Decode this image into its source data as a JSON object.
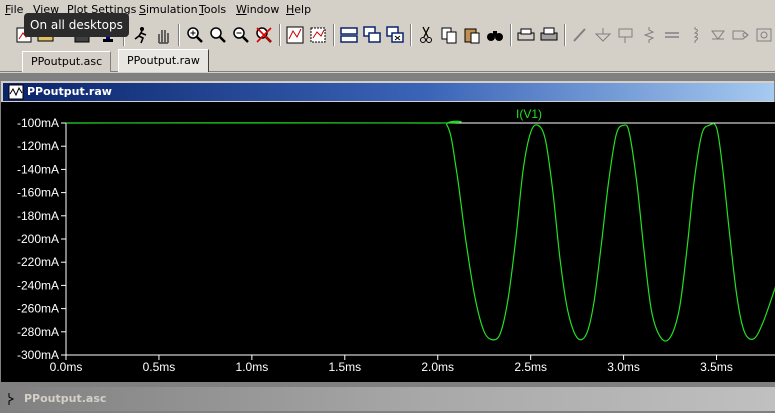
{
  "menu": {
    "items": [
      {
        "label": "File",
        "underline": "F",
        "rest": "ile"
      },
      {
        "label": "View",
        "underline": "V",
        "rest": "iew"
      },
      {
        "label": "Plot Settings",
        "underline": "P",
        "rest": "lot Settings"
      },
      {
        "label": "Simulation",
        "underline": "S",
        "rest": "imulation"
      },
      {
        "label": "Tools",
        "underline": "T",
        "rest": "ools"
      },
      {
        "label": "Window",
        "underline": "W",
        "rest": "indow"
      },
      {
        "label": "Help",
        "underline": "H",
        "rest": "elp"
      }
    ]
  },
  "tooltip": {
    "text": "On all desktops"
  },
  "toolbar": {
    "icons": [
      "new-schematic-icon",
      "open-icon",
      "save-icon",
      "control-panel-icon",
      "run-icon",
      "halt-icon",
      "zoom-in-icon",
      "zoom-to-fit-icon",
      "zoom-out-icon",
      "cancel-zoom-icon",
      "autorange-icon",
      "visible-traces-icon",
      "tile-windows-icon",
      "cascade-windows-icon",
      "close-window-icon",
      "cut-icon",
      "copy-icon",
      "paste-icon",
      "find-icon",
      "print-preview-icon",
      "print-icon",
      "wire-icon",
      "ground-icon",
      "label-net-icon",
      "resistor-icon",
      "capacitor-icon",
      "inductor-icon",
      "diode-icon",
      "component-icon"
    ]
  },
  "tabs": [
    {
      "label": "PPoutput.asc",
      "active": false
    },
    {
      "label": "PPoutput.raw",
      "active": true
    }
  ],
  "plot_window": {
    "title": "PPoutput.raw"
  },
  "schematic_window": {
    "title": "PPoutput.asc"
  },
  "chart_data": {
    "type": "line",
    "title": "",
    "background": "#000000",
    "axis_color": "#ffffff",
    "grid": false,
    "xlabel": "",
    "ylabel": "",
    "xlim": [
      0,
      3.82
    ],
    "ylim": [
      -300,
      -100
    ],
    "x_unit": "ms",
    "y_unit": "mA",
    "xticks": [
      "0.0ms",
      "0.5ms",
      "1.0ms",
      "1.5ms",
      "2.0ms",
      "2.5ms",
      "3.0ms",
      "3.5ms"
    ],
    "xtick_values": [
      0,
      0.5,
      1.0,
      1.5,
      2.0,
      2.5,
      3.0,
      3.5
    ],
    "yticks": [
      "-100mA",
      "-120mA",
      "-140mA",
      "-160mA",
      "-180mA",
      "-200mA",
      "-220mA",
      "-240mA",
      "-260mA",
      "-280mA",
      "-300mA"
    ],
    "ytick_values": [
      -100,
      -120,
      -140,
      -160,
      -180,
      -200,
      -220,
      -240,
      -260,
      -280,
      -300
    ],
    "series": [
      {
        "name": "I(V1)",
        "color": "#22e022",
        "x": [
          0,
          1.95,
          2.05,
          2.1,
          2.15,
          2.2,
          2.25,
          2.3,
          2.34,
          2.38,
          2.42,
          2.46,
          2.5,
          2.54,
          2.58,
          2.62,
          2.66,
          2.7,
          2.75,
          2.8,
          2.84,
          2.88,
          2.92,
          2.96,
          3.0,
          3.03,
          3.07,
          3.11,
          3.15,
          3.2,
          3.25,
          3.3,
          3.34,
          3.38,
          3.42,
          3.46,
          3.5,
          3.53,
          3.57,
          3.61,
          3.65,
          3.7,
          3.75,
          3.82
        ],
        "y": [
          -100,
          -100,
          -102,
          -140,
          -200,
          -250,
          -280,
          -287,
          -280,
          -250,
          -200,
          -140,
          -108,
          -102,
          -115,
          -160,
          -220,
          -262,
          -285,
          -282,
          -255,
          -205,
          -150,
          -110,
          -102,
          -108,
          -150,
          -210,
          -262,
          -285,
          -285,
          -260,
          -210,
          -150,
          -110,
          -102,
          -104,
          -135,
          -195,
          -250,
          -280,
          -286,
          -272,
          -240
        ]
      }
    ]
  }
}
